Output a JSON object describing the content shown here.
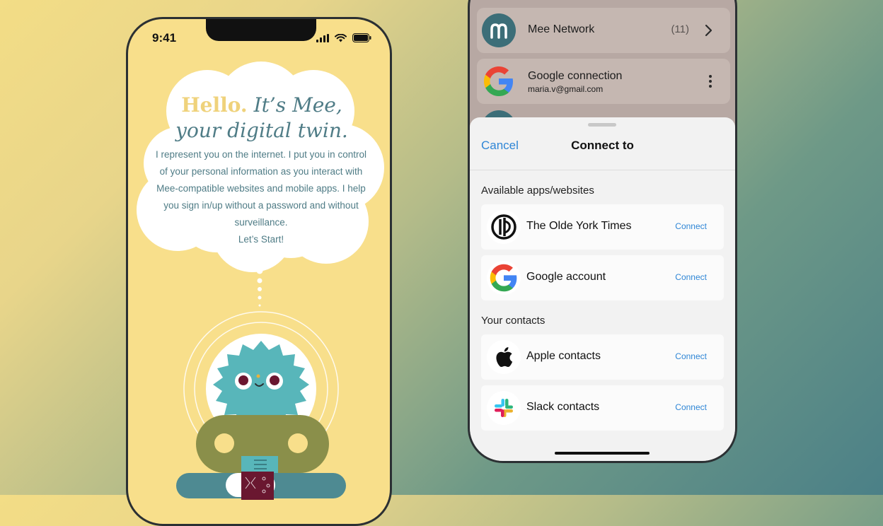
{
  "left_phone": {
    "time": "9:41",
    "headline_hello": "Hello.",
    "headline_rest_1": " It’s Mee,",
    "headline_rest_2": "your digital twin.",
    "body_text": "I represent you on the internet. I put you in control of your personal information as you interact with Mee-compatible websites and mobile apps. I help you sign in/up without a password and without surveillance.",
    "cta": "Let’s Start!"
  },
  "right_phone": {
    "background_rows": [
      {
        "title": "Mee Network",
        "count": "(11)",
        "icon": "mee-logo-icon"
      },
      {
        "title": "Google connection",
        "subtitle": "maria.v@gmail.com",
        "icon": "google-logo-icon"
      }
    ],
    "sheet": {
      "cancel_label": "Cancel",
      "title": "Connect to",
      "section_apps": "Available apps/websites",
      "apps": [
        {
          "name": "The Olde York Times",
          "action": "Connect",
          "icon": "olde-york-times-logo-icon"
        },
        {
          "name": "Google account",
          "action": "Connect",
          "icon": "google-logo-icon"
        }
      ],
      "section_contacts": "Your contacts",
      "contacts": [
        {
          "name": "Apple contacts",
          "action": "Connect",
          "icon": "apple-logo-icon"
        },
        {
          "name": "Slack contacts",
          "action": "Connect",
          "icon": "slack-logo-icon"
        }
      ]
    }
  },
  "colors": {
    "accent_blue": "#2f86d6",
    "teal_text": "#4f7c86",
    "hello_yellow": "#efd27b",
    "phone_yellow": "#f8df8b"
  }
}
